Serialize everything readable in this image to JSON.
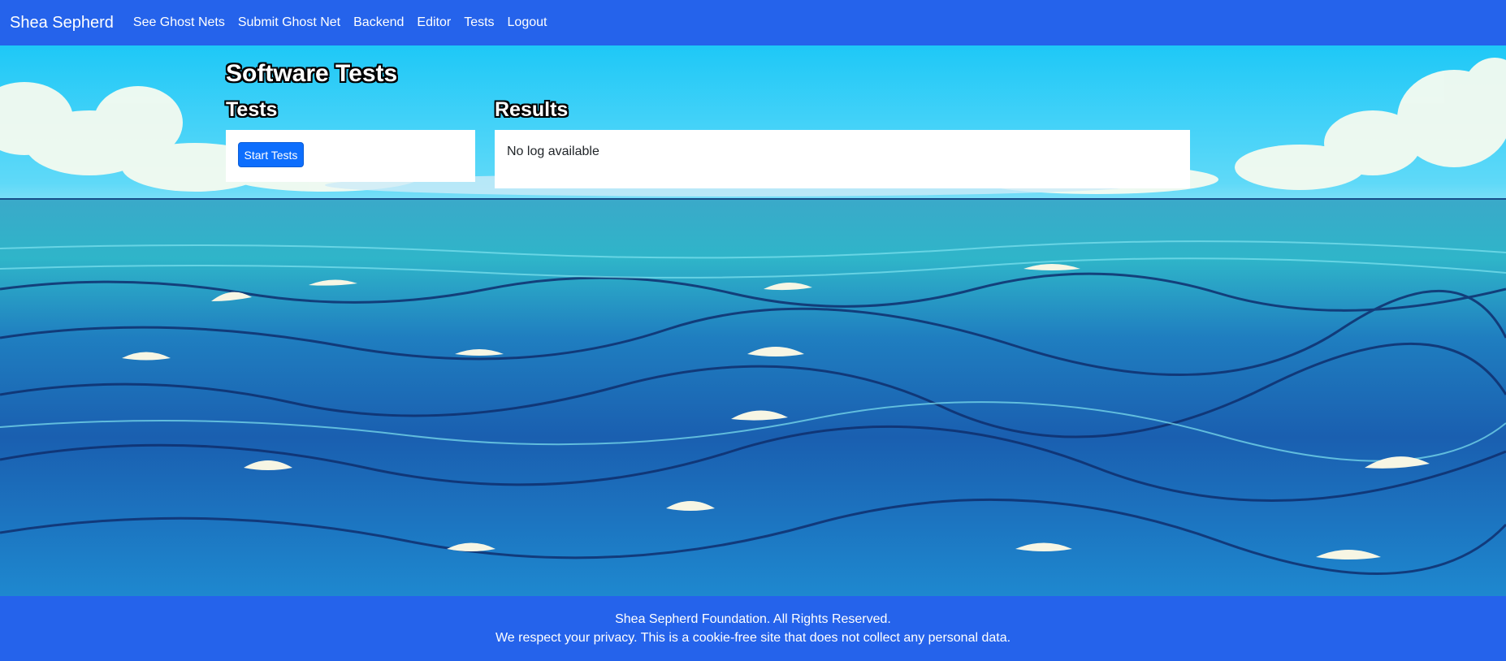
{
  "navbar": {
    "brand": "Shea Sepherd",
    "links": [
      "See Ghost Nets",
      "Submit Ghost Net",
      "Backend",
      "Editor",
      "Tests",
      "Logout"
    ]
  },
  "page": {
    "title": "Software Tests",
    "tests_heading": "Tests",
    "results_heading": "Results",
    "start_button": "Start Tests",
    "log_text": "No log available"
  },
  "footer": {
    "line1": "Shea Sepherd Foundation. All Rights Reserved.",
    "line2": "We respect your privacy. This is a cookie-free site that does not collect any personal data."
  },
  "colors": {
    "navbar": "#2563eb",
    "footer": "#2563eb",
    "button": "#0d6efd"
  }
}
